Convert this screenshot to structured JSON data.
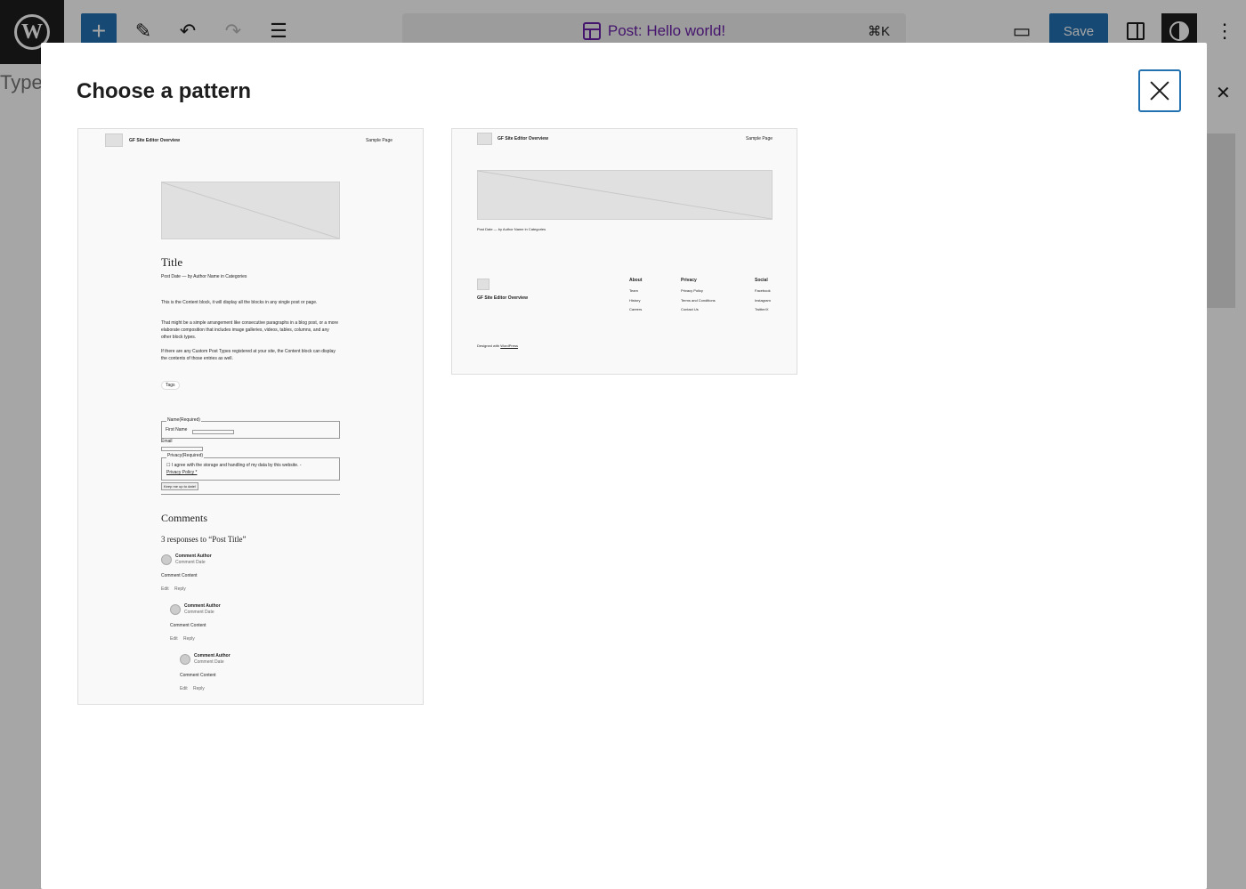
{
  "toolbar": {
    "document_title": "Post: Hello world!",
    "shortcut": "⌘K",
    "save_label": "Save",
    "add_symbol": "+",
    "edit_symbol": "✎",
    "undo_symbol": "↶",
    "redo_symbol": "↷",
    "list_symbol": "☰",
    "laptop_symbol": "▭",
    "more_symbol": "⋮",
    "wp_letter": "W"
  },
  "editor": {
    "type_hint": "Type",
    "side_close": "✕"
  },
  "modal": {
    "title": "Choose a pattern"
  },
  "patterns": [
    {
      "site_title": "GF Site Editor Overview",
      "nav_link": "Sample Page",
      "post_title": "Title",
      "meta": "Post Date — by Author Name in Categories",
      "paragraphs": [
        "This is the Content block, it will display all the blocks in any single post or page.",
        "That might be a simple arrangement like consecutive paragraphs in a blog post, or a more elaborate composition that includes image galleries, videos, tables, columns, and any other block types.",
        "If there are any Custom Post Types registered at your site, the Content block can display the contents of those entries as well."
      ],
      "tags": "Tags",
      "form": {
        "name_legend": "Name(Required)",
        "first_name": "First Name",
        "email": "Email",
        "privacy_legend": "Privacy(Required)",
        "privacy_text": "☐ I agree with the storage and handling of my data by this website. -",
        "privacy_link": "Privacy Policy *",
        "submit": "Keep me up to date!"
      },
      "comments_heading": "Comments",
      "responses": "3 responses to “Post Title”",
      "comments": [
        {
          "author": "Comment Author",
          "date": "Comment Date",
          "content": "Comment Content",
          "edit": "Edit",
          "reply": "Reply"
        },
        {
          "author": "Comment Author",
          "date": "Comment Date",
          "content": "Comment Content",
          "edit": "Edit",
          "reply": "Reply"
        },
        {
          "author": "Comment Author",
          "date": "Comment Date",
          "content": "Comment Content",
          "edit": "Edit",
          "reply": "Reply"
        }
      ]
    },
    {
      "site_title": "GF Site Editor Overview",
      "nav_link": "Sample Page",
      "meta": "Post Date — by Author Name in Categories",
      "footer_site_title": "GF Site Editor Overview",
      "columns": [
        {
          "heading": "About",
          "links": [
            "Team",
            "History",
            "Careers"
          ]
        },
        {
          "heading": "Privacy",
          "links": [
            "Privacy Policy",
            "Terms and Conditions",
            "Contact Us"
          ]
        },
        {
          "heading": "Social",
          "links": [
            "Facebook",
            "Instagram",
            "Twitter/X"
          ]
        }
      ],
      "designed_with": "Designed with",
      "designed_link": "WordPress"
    }
  ]
}
